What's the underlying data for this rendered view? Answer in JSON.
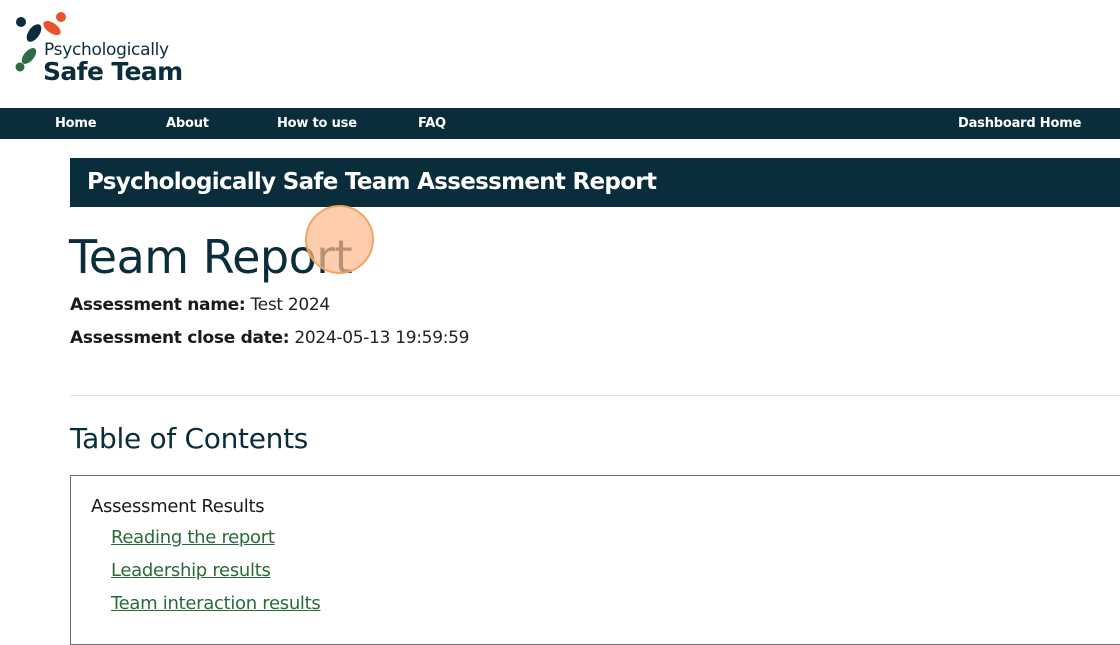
{
  "logo": {
    "line1": "Psychologically",
    "line2": "Safe Team",
    "colors": {
      "navy": "#0a2d3c",
      "red": "#e8532b",
      "green": "#2f6b45"
    }
  },
  "nav": {
    "items": [
      {
        "label": "Home"
      },
      {
        "label": "About"
      },
      {
        "label": "How to use"
      },
      {
        "label": "FAQ"
      }
    ],
    "dashboard_label": "Dashboard Home"
  },
  "banner": {
    "title": "Psychologically Safe Team Assessment Report"
  },
  "report": {
    "title": "Team Report",
    "assessment_name_label": "Assessment name:",
    "assessment_name_value": "Test 2024",
    "close_date_label": "Assessment close date:",
    "close_date_value": "2024-05-13 19:59:59"
  },
  "toc": {
    "heading": "Table of Contents",
    "section_title": "Assessment Results",
    "links": [
      {
        "label": "Reading the report"
      },
      {
        "label": "Leadership results"
      },
      {
        "label": "Team interaction results"
      }
    ]
  },
  "colors": {
    "nav_bg": "#0a2d3c",
    "link": "#2a6a3a",
    "click_indicator": "#fcba8c"
  }
}
